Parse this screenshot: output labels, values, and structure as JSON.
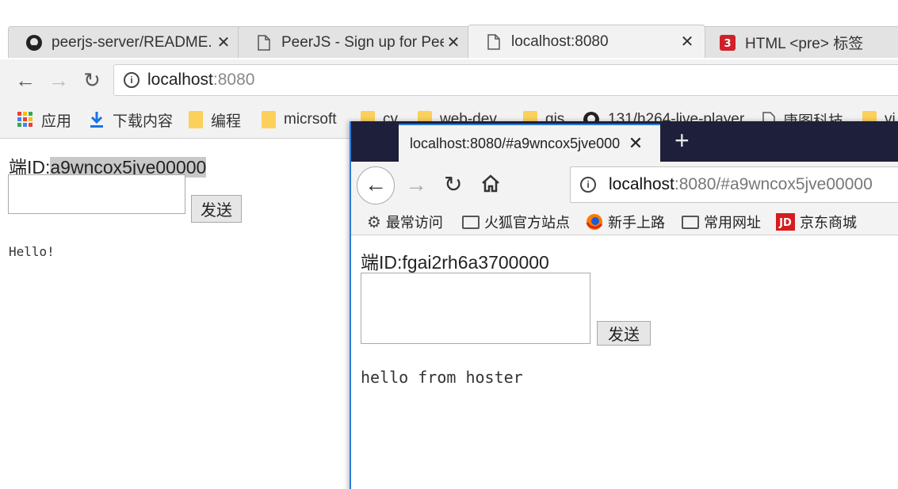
{
  "chrome": {
    "tabs": [
      {
        "title": "peerjs-server/README.",
        "icon": "github-icon"
      },
      {
        "title": "PeerJS - Sign up for Pee",
        "icon": "page-icon"
      },
      {
        "title": "localhost:8080",
        "icon": "page-icon"
      },
      {
        "title": "HTML <pre> 标签",
        "icon": "w3school-icon"
      }
    ],
    "active_tab": 2,
    "url": {
      "host": "localhost",
      "port": ":8080"
    },
    "bookmarks": [
      {
        "label": "应用",
        "icon": "apps-icon"
      },
      {
        "label": "下载内容",
        "icon": "download-icon"
      },
      {
        "label": "编程",
        "icon": "folder-icon"
      },
      {
        "label": "micrsoft",
        "icon": "folder-icon"
      },
      {
        "label": "cv",
        "icon": "folder-icon"
      },
      {
        "label": "web-dev",
        "icon": "folder-icon"
      },
      {
        "label": "gis",
        "icon": "folder-icon"
      },
      {
        "label": "131/h264-live-player",
        "icon": "github-icon"
      },
      {
        "label": "唐图科技",
        "icon": "page-icon"
      },
      {
        "label": "vi",
        "icon": "folder-icon"
      }
    ],
    "page": {
      "peer_label": "端ID:",
      "peer_id": "a9wncox5jve00000",
      "send_label": "发送",
      "message": "Hello!"
    }
  },
  "firefox": {
    "tab_title": "localhost:8080/#a9wncox5jve000",
    "url": {
      "host": "localhost",
      "rest": ":8080/#a9wncox5jve00000"
    },
    "bookmarks": [
      {
        "label": "最常访问",
        "icon": "gear-icon"
      },
      {
        "label": "火狐官方站点",
        "icon": "folder-icon"
      },
      {
        "label": "新手上路",
        "icon": "firefox-icon"
      },
      {
        "label": "常用网址",
        "icon": "folder-icon"
      },
      {
        "label": "京东商城",
        "icon": "jd-icon"
      }
    ],
    "page": {
      "peer_label": "端ID:",
      "peer_id": "fgai2rh6a3700000",
      "send_label": "发送",
      "message": "hello from hoster"
    }
  }
}
